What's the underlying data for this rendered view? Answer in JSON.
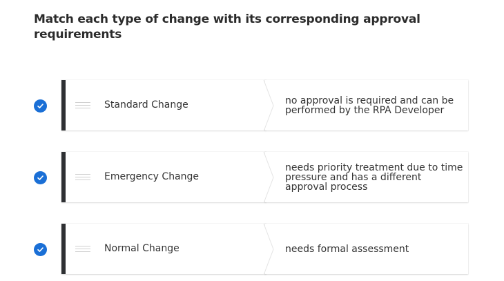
{
  "question": {
    "title": "Match each type of change with its corresponding approval requirements"
  },
  "pairs": [
    {
      "term": "Standard Change",
      "definition": "no approval is required and can be performed by the RPA Developer",
      "status": "correct"
    },
    {
      "term": "Emergency Change",
      "definition": "needs priority treatment due to time pressure and has a different approval process",
      "status": "correct"
    },
    {
      "term": "Normal Change",
      "definition": "needs formal assessment",
      "status": "correct"
    }
  ],
  "colors": {
    "check": "#1a6fd6",
    "term_border": "#2e3033",
    "text": "#333333"
  },
  "icons": {
    "status": "checkmark-circle-icon",
    "drag": "drag-handle-icon"
  }
}
